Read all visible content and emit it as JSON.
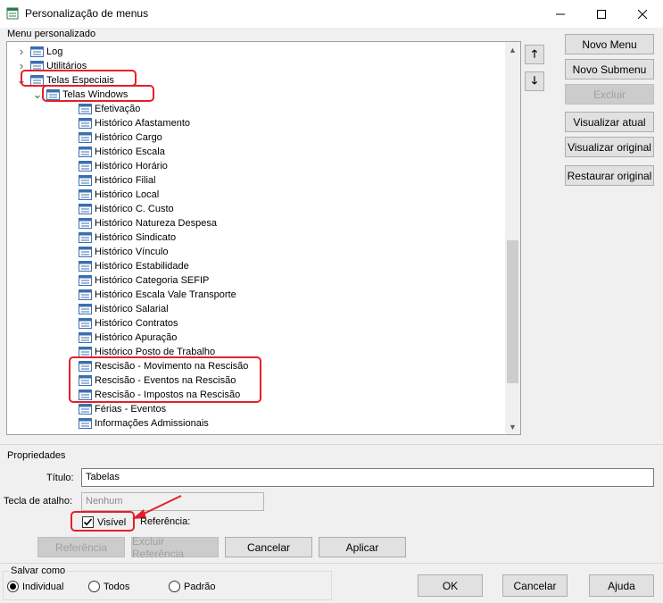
{
  "window": {
    "title": "Personalização de menus",
    "min_glyph": "—",
    "max_glyph": "☐",
    "close_glyph": "✕"
  },
  "menu_group": {
    "label": "Menu personalizado"
  },
  "tree": {
    "items": [
      {
        "label": "Log",
        "level": 1,
        "expander": "collapsed",
        "highlight": false
      },
      {
        "label": "Utilitários",
        "level": 1,
        "expander": "collapsed",
        "highlight": false
      },
      {
        "label": "Telas Especiais",
        "level": 1,
        "expander": "expanded",
        "highlight": true
      },
      {
        "label": "Telas Windows",
        "level": 2,
        "expander": "expanded",
        "highlight": true,
        "selected": true
      },
      {
        "label": "Efetivação",
        "level": 3,
        "expander": "none"
      },
      {
        "label": "Histórico Afastamento",
        "level": 3,
        "expander": "none"
      },
      {
        "label": "Histórico Cargo",
        "level": 3,
        "expander": "none"
      },
      {
        "label": "Histórico Escala",
        "level": 3,
        "expander": "none"
      },
      {
        "label": "Histórico Horário",
        "level": 3,
        "expander": "none"
      },
      {
        "label": "Histórico Filial",
        "level": 3,
        "expander": "none"
      },
      {
        "label": "Histórico Local",
        "level": 3,
        "expander": "none"
      },
      {
        "label": "Histórico C. Custo",
        "level": 3,
        "expander": "none"
      },
      {
        "label": "Histórico Natureza Despesa",
        "level": 3,
        "expander": "none"
      },
      {
        "label": "Histórico Sindicato",
        "level": 3,
        "expander": "none"
      },
      {
        "label": "Histórico Vínculo",
        "level": 3,
        "expander": "none"
      },
      {
        "label": "Histórico Estabilidade",
        "level": 3,
        "expander": "none"
      },
      {
        "label": "Histórico Categoria SEFIP",
        "level": 3,
        "expander": "none"
      },
      {
        "label": "Histórico Escala Vale Transporte",
        "level": 3,
        "expander": "none"
      },
      {
        "label": "Histórico Salarial",
        "level": 3,
        "expander": "none"
      },
      {
        "label": "Histórico Contratos",
        "level": 3,
        "expander": "none"
      },
      {
        "label": "Histórico Apuração",
        "level": 3,
        "expander": "none"
      },
      {
        "label": "Histórico Posto de Trabalho",
        "level": 3,
        "expander": "none"
      },
      {
        "label": "Rescisão - Movimento na Rescisão",
        "level": 3,
        "expander": "none"
      },
      {
        "label": "Rescisão - Eventos na Rescisão",
        "level": 3,
        "expander": "none"
      },
      {
        "label": "Rescisão - Impostos na Rescisão",
        "level": 3,
        "expander": "none"
      },
      {
        "label": "Férias - Eventos",
        "level": 3,
        "expander": "none"
      },
      {
        "label": "Informações Admissionais",
        "level": 3,
        "expander": "none"
      }
    ]
  },
  "move_buttons": {
    "up_glyph": "🡑",
    "down_glyph": "🡓"
  },
  "side_buttons": {
    "novo_menu": "Novo Menu",
    "novo_submenu": "Novo Submenu",
    "excluir": "Excluir",
    "visualizar_atual": "Visualizar atual",
    "visualizar_original": "Visualizar original",
    "restaurar_original": "Restaurar original"
  },
  "properties": {
    "group_label": "Propriedades",
    "titulo_label": "Título:",
    "titulo_value": "Tabelas",
    "atalho_label": "Tecla de atalho:",
    "atalho_value": "Nenhum",
    "visivel_label": "Visível",
    "visivel_checked": true,
    "referencia_label": "Referência:",
    "btn_referencia": "Referência",
    "btn_excluir_referencia": "Excluir Referência",
    "btn_cancelar": "Cancelar",
    "btn_aplicar": "Aplicar"
  },
  "save_as": {
    "group_label": "Salvar como",
    "options": [
      {
        "label": "Individual",
        "selected": true
      },
      {
        "label": "Todos",
        "selected": false
      },
      {
        "label": "Padrão",
        "selected": false
      }
    ]
  },
  "footer": {
    "ok": "OK",
    "cancel": "Cancelar",
    "help": "Ajuda"
  },
  "colors": {
    "annotation_red": "#e3202a",
    "window_bg": "#f0f0f0"
  }
}
